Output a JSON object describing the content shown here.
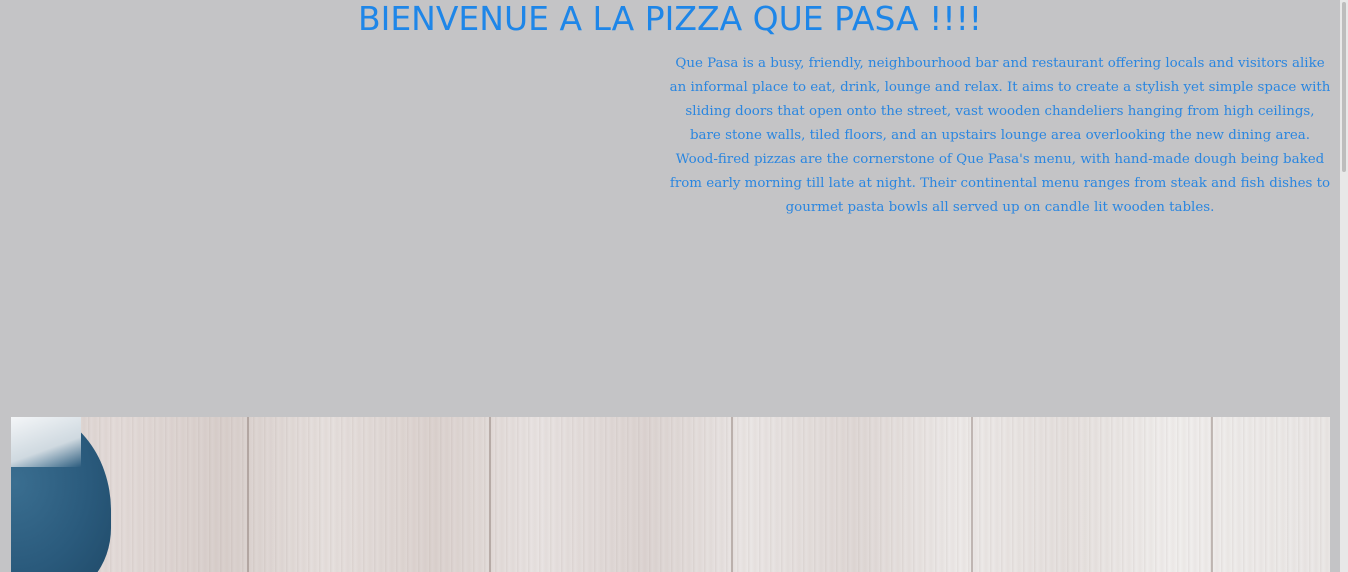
{
  "header": {
    "title": "BIENVENUE A LA PIZZA QUE PASA !!!!"
  },
  "intro": {
    "text": "Que Pasa is a busy, friendly, neighbourhood bar and restaurant offering locals and visitors alike an informal place to eat, drink, lounge and relax. It aims to create a stylish yet simple space with sliding doors that open onto the street, vast wooden chandeliers hanging from high ceilings, bare stone walls, tiled floors, and an upstairs lounge area overlooking the new dining area. Wood-fired pizzas are the cornerstone of Que Pasa's menu, with hand-made dough being baked from early morning till late at night. Their continental menu ranges from steak and fish dishes to gourmet pasta bowls all served up on candle lit wooden tables."
  },
  "colors": {
    "background": "#c4c4c6",
    "accent_text": "#1e86e8"
  }
}
